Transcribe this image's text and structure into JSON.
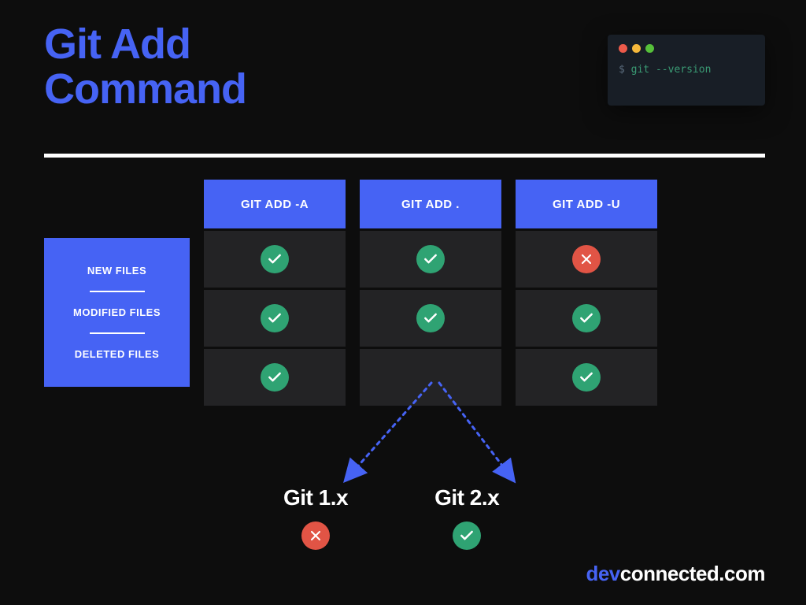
{
  "title_line1": "Git Add",
  "title_line2": "Command",
  "terminal": {
    "prompt": "$ ",
    "command": "git --version"
  },
  "row_labels": [
    "NEW FILES",
    "MODIFIED FILES",
    "DELETED FILES"
  ],
  "columns": [
    {
      "header": "GIT ADD -A",
      "cells": [
        "check",
        "check",
        "check"
      ]
    },
    {
      "header": "GIT ADD .",
      "cells": [
        "check",
        "check",
        "branch"
      ]
    },
    {
      "header": "GIT ADD -U",
      "cells": [
        "cross",
        "check",
        "check"
      ]
    }
  ],
  "branch_targets": [
    {
      "label": "Git 1.x",
      "icon": "cross"
    },
    {
      "label": "Git 2.x",
      "icon": "check"
    }
  ],
  "footer_accent": "dev",
  "footer_rest": "connected.com",
  "chart_data": {
    "type": "table",
    "title": "Git Add Command",
    "rows": [
      "NEW FILES",
      "MODIFIED FILES",
      "DELETED FILES"
    ],
    "columns": [
      "GIT ADD -A",
      "GIT ADD .",
      "GIT ADD -U"
    ],
    "matrix": [
      [
        true,
        true,
        false
      ],
      [
        true,
        true,
        true
      ],
      [
        true,
        {
          "Git 1.x": false,
          "Git 2.x": true
        },
        true
      ]
    ],
    "note": "third row, second column value depends on Git version"
  }
}
